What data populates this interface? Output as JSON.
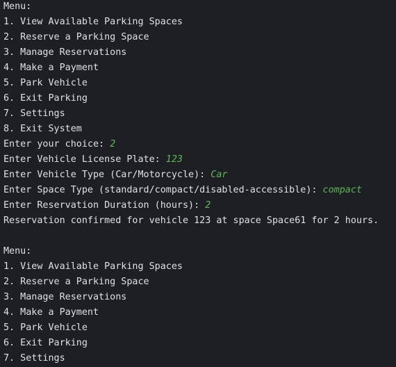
{
  "colors": {
    "background": "#1e1f22",
    "text": "#dfe1e5",
    "user_input": "#5fb85a"
  },
  "first_menu": {
    "title": "Menu:",
    "items": [
      "1. View Available Parking Spaces",
      "2. Reserve a Parking Space",
      "3. Manage Reservations",
      "4. Make a Payment",
      "5. Park Vehicle",
      "6. Exit Parking",
      "7. Settings",
      "8. Exit System"
    ]
  },
  "prompts": [
    {
      "label": "Enter your choice: ",
      "value": "2"
    },
    {
      "label": "Enter Vehicle License Plate: ",
      "value": "123"
    },
    {
      "label": "Enter Vehicle Type (Car/Motorcycle): ",
      "value": "Car"
    },
    {
      "label": "Enter Space Type (standard/compact/disabled-accessible): ",
      "value": "compact"
    },
    {
      "label": "Enter Reservation Duration (hours): ",
      "value": "2"
    }
  ],
  "confirmation": "Reservation confirmed for vehicle 123 at space Space61 for 2 hours.",
  "second_menu": {
    "title": "Menu:",
    "items": [
      "1. View Available Parking Spaces",
      "2. Reserve a Parking Space",
      "3. Manage Reservations",
      "4. Make a Payment",
      "5. Park Vehicle",
      "6. Exit Parking",
      "7. Settings"
    ]
  }
}
